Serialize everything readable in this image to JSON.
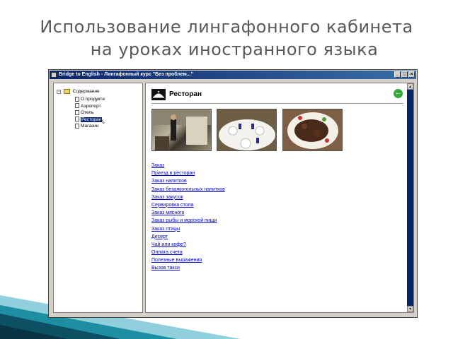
{
  "slide": {
    "title_line1": "Использование лингафонного кабинета",
    "title_line2": "на уроках иностранного языка"
  },
  "window": {
    "title": "Bridge to English - Лингафонный курс \"Без проблем...\"",
    "buttons": {
      "minimize": "_",
      "maximize": "□",
      "close": "×"
    }
  },
  "tree": {
    "root_toggle": "−",
    "root_label": "Содержание",
    "items": [
      {
        "label": "О продукте"
      },
      {
        "label": "Аэропорт"
      },
      {
        "label": "Отель"
      },
      {
        "label": "Ресторан",
        "selected": true
      },
      {
        "label": "Магазин"
      }
    ]
  },
  "content": {
    "heading": "Ресторан",
    "back_icon": "arrow-left-icon",
    "links": [
      "Заказ",
      "Приезд в ресторан",
      "Заказ напитков",
      "Заказ безалкогольных напитков",
      "Заказ закусок",
      "Сервировка стола",
      "Заказ мясного",
      "Заказ рыбы и морской пищи",
      "Заказ птицы",
      "Десерт",
      "Чай или кофе?",
      "Оплата счета",
      "Полезные выражения",
      "Вызов такси"
    ]
  },
  "colors": {
    "slide_title": "#595959",
    "titlebar": "#0a246a",
    "link": "#0000cc",
    "back_button": "#3aa83a",
    "deco_teal": "#1e8fa3"
  }
}
